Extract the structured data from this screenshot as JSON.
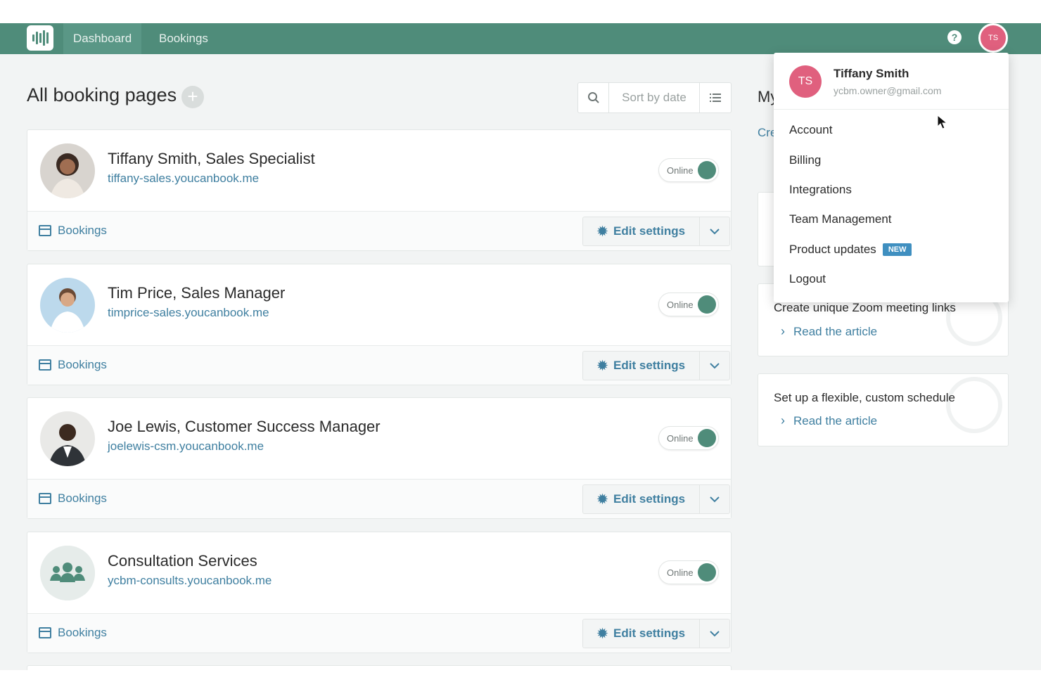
{
  "nav": {
    "items": [
      {
        "label": "Dashboard"
      },
      {
        "label": "Bookings"
      }
    ]
  },
  "header": {
    "help_icon": "question-circle-icon",
    "avatar_initials": "TS"
  },
  "main": {
    "title": "All booking pages",
    "sort_label": "Sort by date",
    "cards": [
      {
        "name": "Tiffany Smith, Sales Specialist",
        "url": "tiffany-sales.youcanbook.me",
        "status": "Online",
        "bookings_label": "Bookings",
        "edit_label": "Edit settings"
      },
      {
        "name": "Tim Price, Sales Manager",
        "url": "timprice-sales.youcanbook.me",
        "status": "Online",
        "bookings_label": "Bookings",
        "edit_label": "Edit settings"
      },
      {
        "name": "Joe Lewis, Customer Success Manager",
        "url": "joelewis-csm.youcanbook.me",
        "status": "Online",
        "bookings_label": "Bookings",
        "edit_label": "Edit settings"
      },
      {
        "name": "Consultation Services",
        "url": "ycbm-consults.youcanbook.me",
        "status": "Online",
        "bookings_label": "Bookings",
        "edit_label": "Edit settings"
      }
    ]
  },
  "sidebar": {
    "title_partial": "My",
    "link_partial": "Cre",
    "articles": [
      {
        "text": "Create unique Zoom meeting links",
        "link": "Read the article"
      },
      {
        "text": "Set up a flexible, custom schedule",
        "link": "Read the article"
      }
    ]
  },
  "user_menu": {
    "initials": "TS",
    "name": "Tiffany Smith",
    "email": "ycbm.owner@gmail.com",
    "items": [
      {
        "label": "Account"
      },
      {
        "label": "Billing"
      },
      {
        "label": "Integrations"
      },
      {
        "label": "Team Management"
      },
      {
        "label": "Product updates",
        "badge": "NEW"
      },
      {
        "label": "Logout"
      }
    ]
  },
  "colors": {
    "brand": "#4f8c7a",
    "link": "#3f7fa0",
    "avatar": "#e0607e",
    "badge": "#3f8fc0"
  }
}
